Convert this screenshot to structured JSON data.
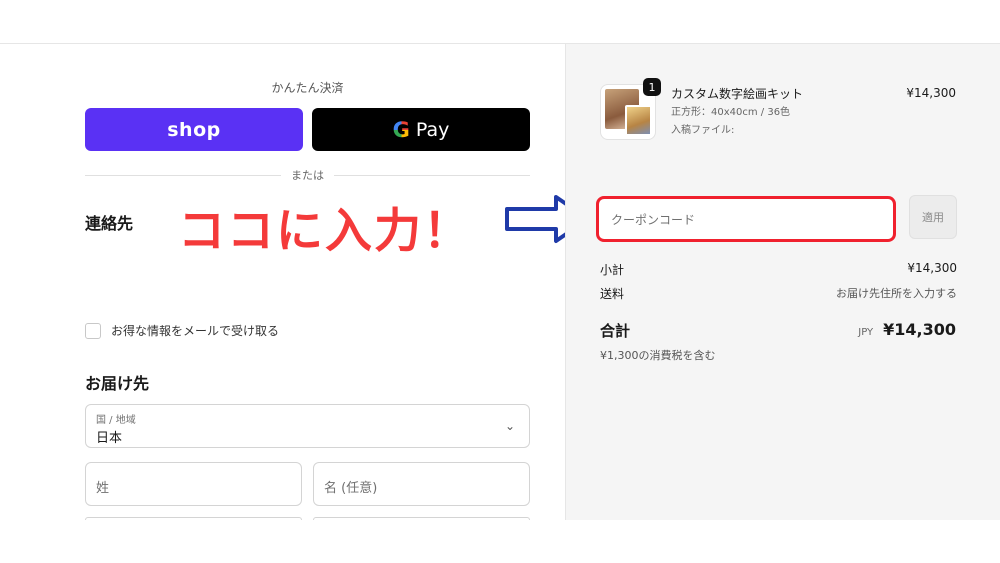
{
  "express": {
    "title": "かんたん決済",
    "shop_label": "shop",
    "gpay_g": "G",
    "gpay_label": "Pay",
    "or": "または"
  },
  "contact": {
    "heading": "連絡先",
    "annotation": "ココに入力！"
  },
  "newsletter": {
    "label": "お得な情報をメールで受け取る",
    "checked": false
  },
  "delivery": {
    "heading": "お届け先",
    "country_label": "国 / 地域",
    "country_value": "日本",
    "last_name_placeholder": "姓",
    "first_name_placeholder": "名 (任意)"
  },
  "summary": {
    "item": {
      "quantity": "1",
      "title": "カスタム数字絵画キット",
      "variant": "正方形：40x40cm / 36色",
      "file_label": "入稿ファイル:",
      "price": "¥14,300"
    },
    "coupon_placeholder": "クーポンコード",
    "apply_label": "適用",
    "subtotal_label": "小計",
    "subtotal_value": "¥14,300",
    "shipping_label": "送料",
    "shipping_value": "お届け先住所を入力する",
    "total_label": "合計",
    "total_currency": "JPY",
    "total_value": "¥14,300",
    "tax_note": "¥1,300の消費税を含む"
  },
  "colors": {
    "shop_purple": "#5a31f4",
    "annotation_red": "#f43a3a",
    "coupon_highlight": "#f0212e",
    "arrow_blue": "#1f3aa8"
  }
}
